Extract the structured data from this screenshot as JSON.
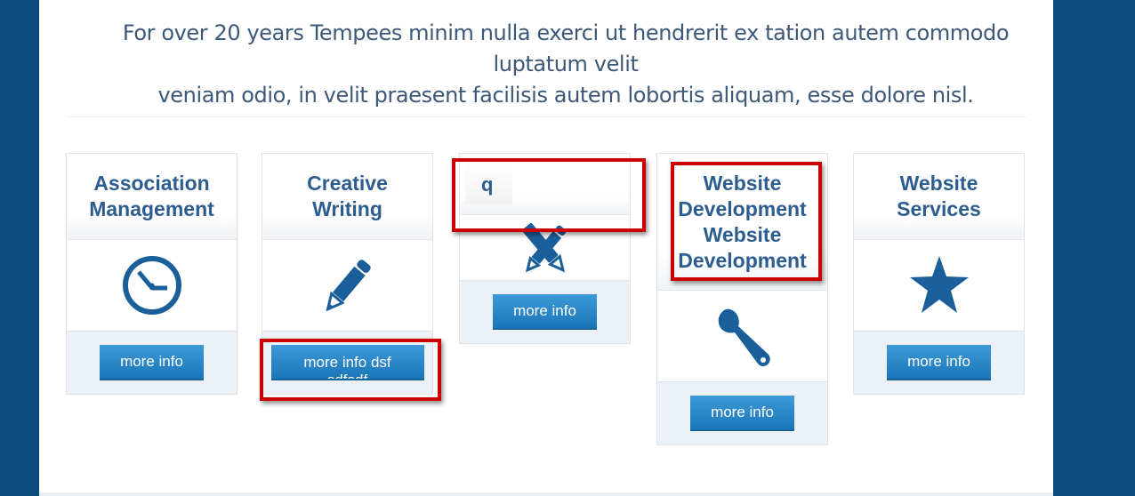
{
  "intro": {
    "line1": "For over 20 years Tempees minim nulla exerci ut hendrerit ex tation autem commodo luptatum velit",
    "line2": "veniam odio, in velit praesent facilisis autem lobortis aliquam, esse dolore nisl."
  },
  "cards": [
    {
      "title_line1": "Association",
      "title_line2": "Management",
      "icon": "clock-icon",
      "button": "more info"
    },
    {
      "title_line1": "Creative",
      "title_line2": "Writing",
      "icon": "pencil-icon",
      "button_line1": "more info dsf",
      "button_line2": "sdfsdf"
    },
    {
      "title": "q",
      "icon": "design-tools-icon",
      "button": "more info"
    },
    {
      "title_lines": [
        "Website",
        "Development",
        "Website",
        "Development"
      ],
      "icon": "wrench-icon",
      "button": "more info"
    },
    {
      "title_line1": "Website",
      "title_line2": "Services",
      "icon": "star-icon",
      "button": "more info"
    }
  ],
  "colors": {
    "background": "#0b4a7c",
    "accent": "#1b76b8",
    "title": "#2d5d8e",
    "highlight": "#cc0000"
  }
}
